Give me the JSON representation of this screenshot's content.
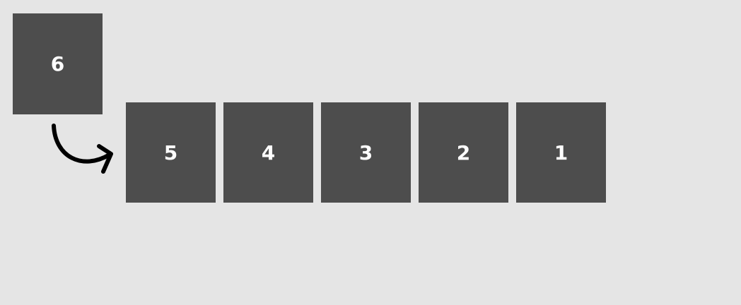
{
  "incoming": {
    "label": "6"
  },
  "queue": {
    "items": [
      "5",
      "4",
      "3",
      "2",
      "1"
    ]
  },
  "arrow": {
    "icon": "curved-arrow-right-icon"
  },
  "colors": {
    "background": "#e5e5e5",
    "box": "#4d4d4d",
    "text": "#ffffff",
    "arrow": "#000000"
  }
}
